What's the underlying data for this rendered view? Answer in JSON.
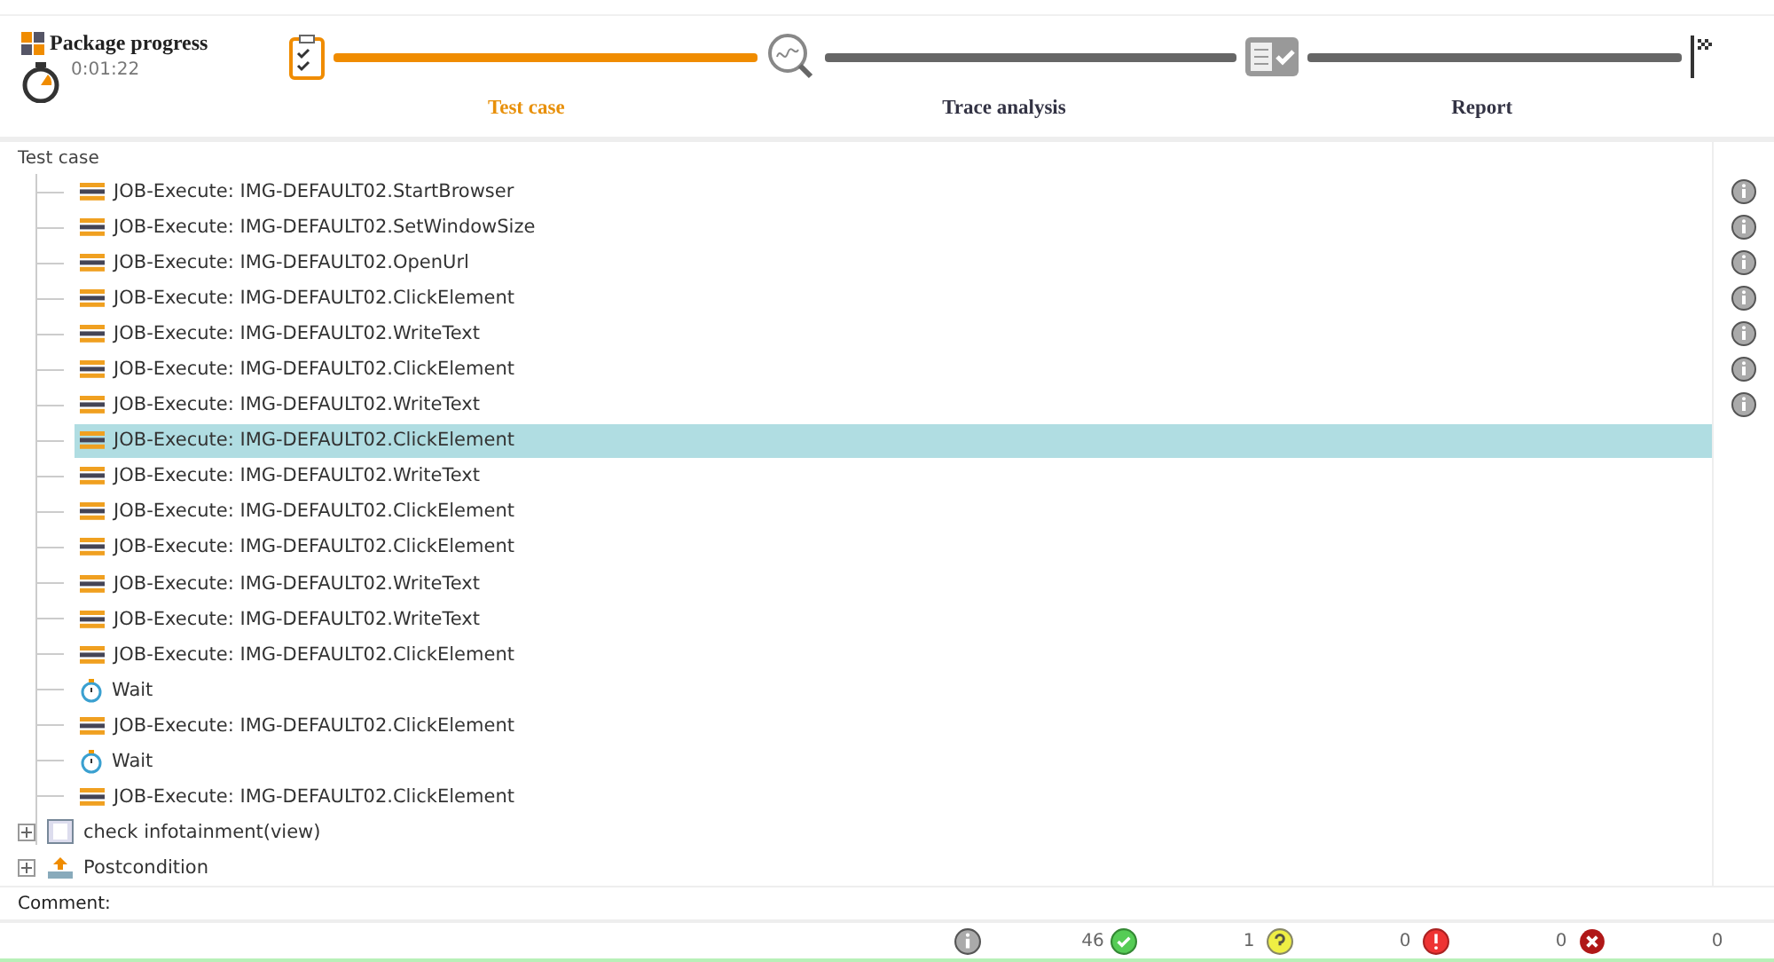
{
  "header": {
    "title": "Package progress",
    "elapsed": "0:01:22"
  },
  "stepper": [
    {
      "label": "Test case",
      "kind": "testcase",
      "selected": true
    },
    {
      "label": "Trace analysis",
      "kind": "trace",
      "selected": false
    },
    {
      "label": "Report",
      "kind": "report",
      "selected": false
    }
  ],
  "tree": {
    "heading": "Test case",
    "items": [
      {
        "kind": "job",
        "label": "JOB-Execute: IMG-DEFAULT02.StartBrowser",
        "info": true,
        "selected": false
      },
      {
        "kind": "job",
        "label": "JOB-Execute: IMG-DEFAULT02.SetWindowSize",
        "info": true,
        "selected": false
      },
      {
        "kind": "job",
        "label": "JOB-Execute: IMG-DEFAULT02.OpenUrl",
        "info": true,
        "selected": false
      },
      {
        "kind": "job",
        "label": "JOB-Execute: IMG-DEFAULT02.ClickElement",
        "info": true,
        "selected": false
      },
      {
        "kind": "job",
        "label": "JOB-Execute: IMG-DEFAULT02.WriteText",
        "info": true,
        "selected": false
      },
      {
        "kind": "job",
        "label": "JOB-Execute: IMG-DEFAULT02.ClickElement",
        "info": true,
        "selected": false
      },
      {
        "kind": "job",
        "label": "JOB-Execute: IMG-DEFAULT02.WriteText",
        "info": true,
        "selected": false
      },
      {
        "kind": "job",
        "label": "JOB-Execute: IMG-DEFAULT02.ClickElement",
        "info": false,
        "selected": true
      },
      {
        "kind": "job",
        "label": "JOB-Execute: IMG-DEFAULT02.WriteText",
        "info": false,
        "selected": false
      },
      {
        "kind": "job",
        "label": "JOB-Execute: IMG-DEFAULT02.ClickElement",
        "info": false,
        "selected": false
      },
      {
        "kind": "job",
        "label": "JOB-Execute: IMG-DEFAULT02.ClickElement",
        "info": false,
        "selected": false
      },
      {
        "kind": "job",
        "label": "JOB-Execute: IMG-DEFAULT02.WriteText",
        "info": false,
        "selected": false
      },
      {
        "kind": "job",
        "label": "JOB-Execute: IMG-DEFAULT02.WriteText",
        "info": false,
        "selected": false
      },
      {
        "kind": "job",
        "label": "JOB-Execute: IMG-DEFAULT02.ClickElement",
        "info": false,
        "selected": false
      },
      {
        "kind": "wait",
        "label": "Wait",
        "info": false,
        "selected": false
      },
      {
        "kind": "job",
        "label": "JOB-Execute: IMG-DEFAULT02.ClickElement",
        "info": false,
        "selected": false
      },
      {
        "kind": "wait",
        "label": "Wait",
        "info": false,
        "selected": false
      },
      {
        "kind": "job",
        "label": "JOB-Execute: IMG-DEFAULT02.ClickElement",
        "info": false,
        "selected": false
      }
    ],
    "groups": [
      {
        "kind": "check",
        "label": "check infotainment(view)",
        "expanded": false
      },
      {
        "kind": "postcondition",
        "label": "Postcondition",
        "expanded": false
      }
    ]
  },
  "comment": {
    "label": "Comment:"
  },
  "status_bar": [
    {
      "kind": "info",
      "count": "46"
    },
    {
      "kind": "ok",
      "count": "1"
    },
    {
      "kind": "question",
      "count": "0"
    },
    {
      "kind": "error",
      "count": "0"
    },
    {
      "kind": "fatal",
      "count": "0"
    }
  ]
}
